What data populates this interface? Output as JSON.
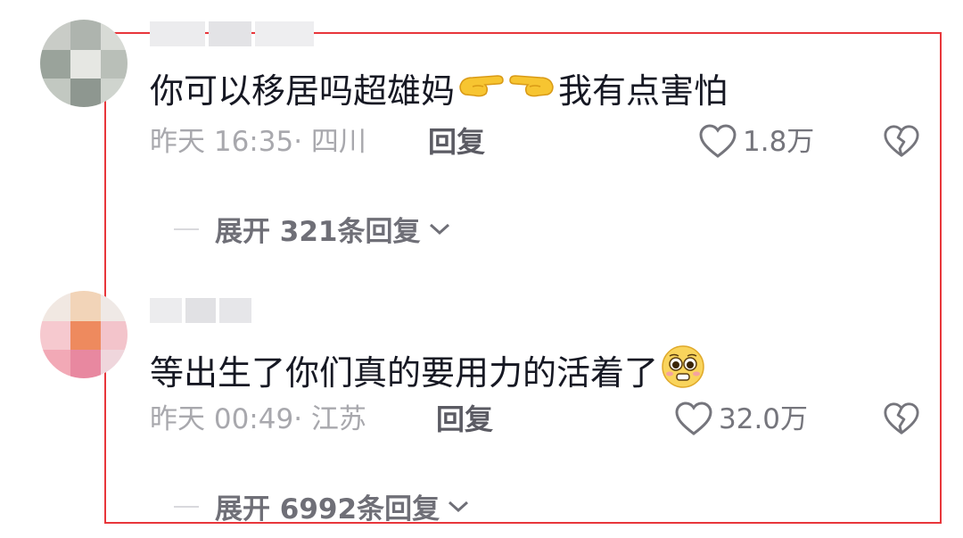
{
  "comments": [
    {
      "text_before": "你可以移居吗超雄妈",
      "text_after": "我有点害怕",
      "emojis": [
        "pointing-right-hand-emoji",
        "pointing-left-hand-emoji"
      ],
      "meta": "昨天 16:35· 四川",
      "reply_label": "回复",
      "likes": "1.8万",
      "expand_label": "展开 321条回复"
    },
    {
      "text_before": "等出生了你们真的要用力的活着了",
      "text_after": "",
      "emojis": [
        "pleading-face-emoji"
      ],
      "meta": "昨天 00:49· 江苏",
      "reply_label": "回复",
      "likes": "32.0万",
      "expand_label": "展开 6992条回复"
    }
  ],
  "colors": {
    "highlight_border": "#e8363b",
    "meta_text": "#a8a8ad",
    "icon": "#75757c"
  }
}
